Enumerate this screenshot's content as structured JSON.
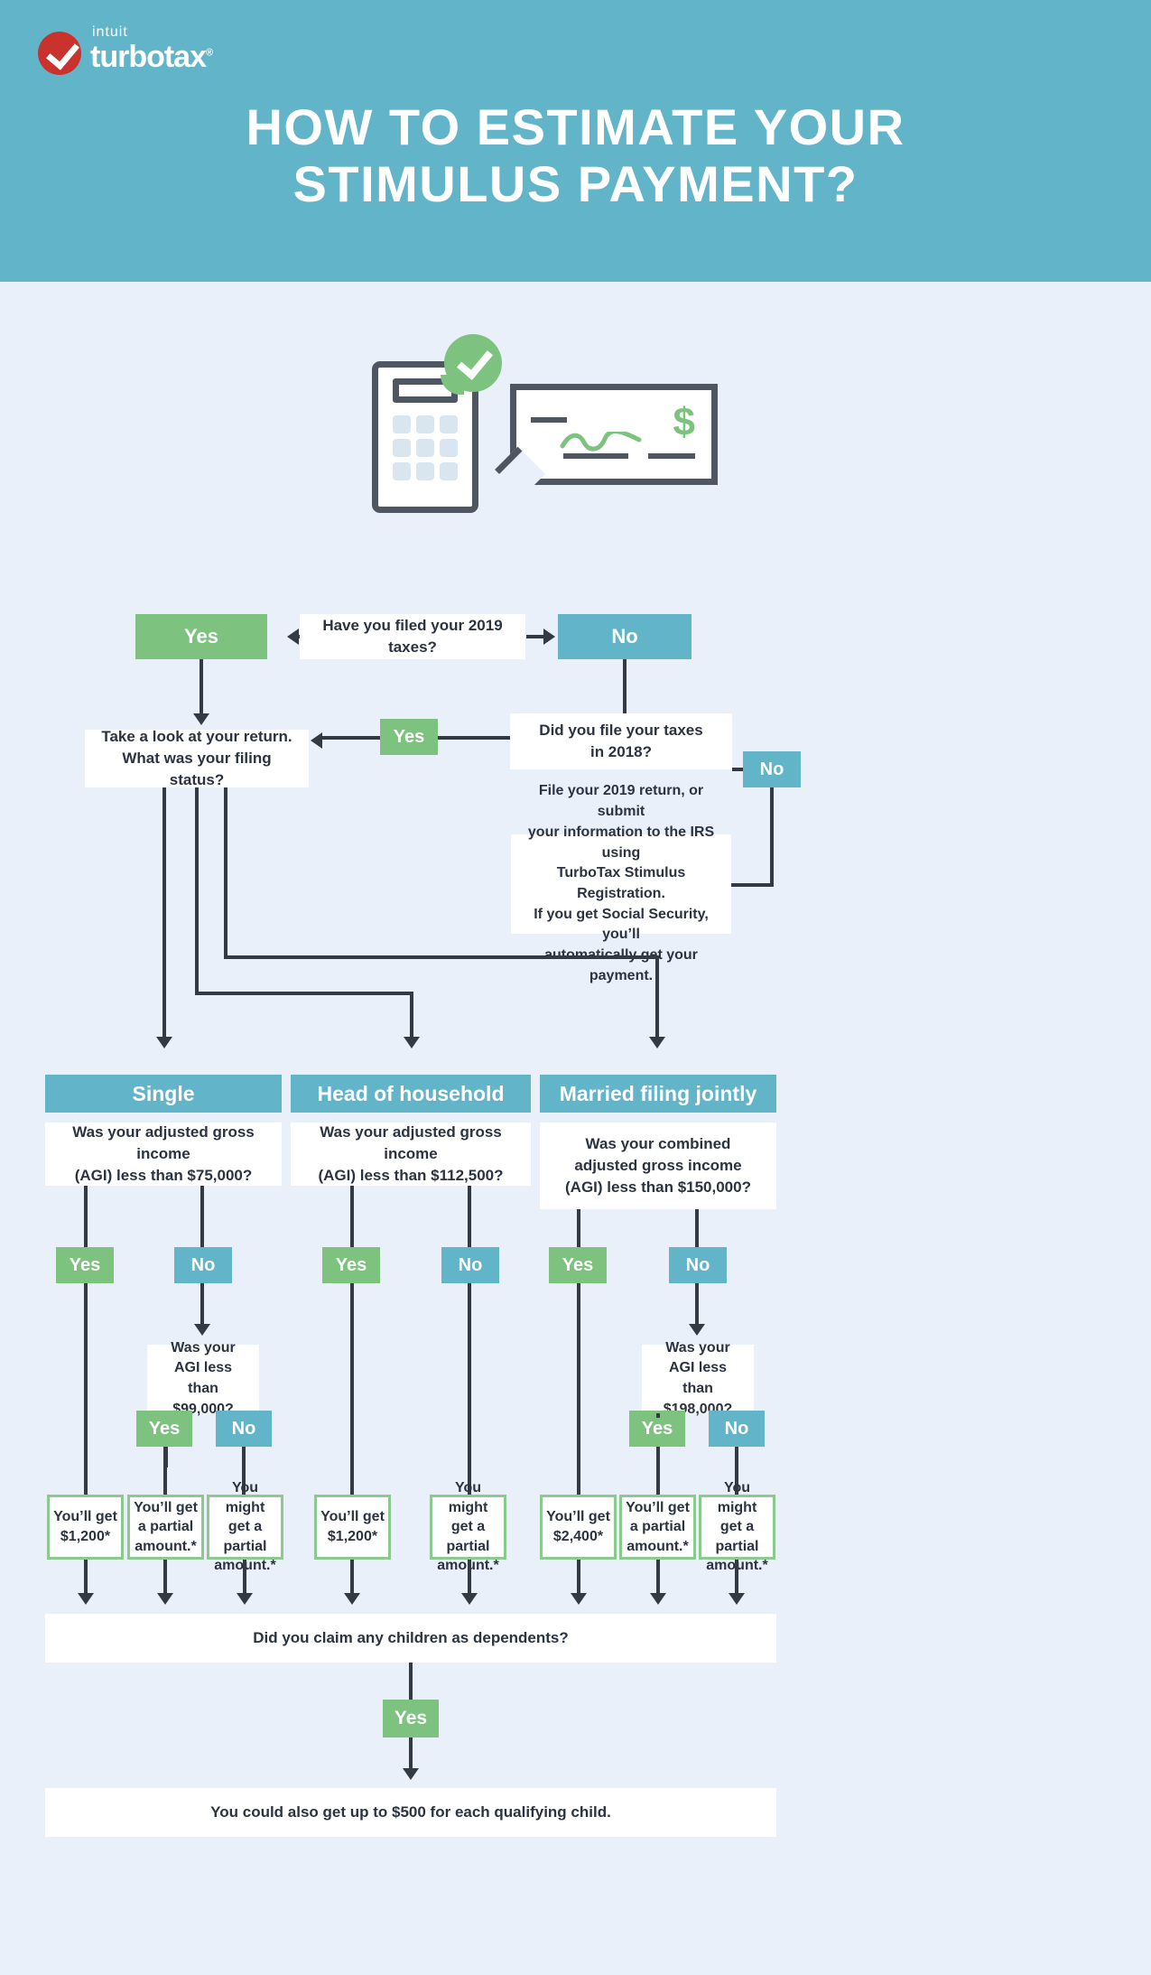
{
  "brand": {
    "intuit": "intuit",
    "product": "turbotax",
    "registered": "®",
    "accent_teal": "#62b4c8",
    "accent_green": "#7dc27f",
    "accent_red": "#c9322d",
    "page_bg": "#eaf0fa",
    "ink": "#333a42"
  },
  "header": {
    "title_line1": "HOW TO ESTIMATE YOUR",
    "title_line2": "STIMULUS PAYMENT?"
  },
  "illustration": {
    "calculator_icon": "calculator-icon",
    "check_badge_icon": "green-check-badge-icon",
    "check_icon": "paper-check-icon",
    "dollar_symbol": "$"
  },
  "labels": {
    "yes": "Yes",
    "no": "No"
  },
  "flow": {
    "q_filed_2019": "Have you filed your 2019 taxes?",
    "q_take_a_look": "Take a look at your return. What was your filing status?",
    "q_take_a_look_l1": "Take a look at your return.",
    "q_take_a_look_l2": "What was your filing status?",
    "q_filed_2018_l1": "Did you file your taxes",
    "q_filed_2018_l2": "in 2018?",
    "note_register_l1": "File your 2019 return, or submit",
    "note_register_l2": "your information to the IRS using",
    "note_register_l3": "TurboTax Stimulus Registration.",
    "note_register_l4": "If you get Social Security, you’ll",
    "note_register_l5": "automatically get your payment."
  },
  "columns": [
    {
      "id": "single",
      "header": "Single",
      "question_lead_l1": "Was your adjusted gross income",
      "question_lead_l2": "(AGI) less than ",
      "question_amount": "$75,000?",
      "branch_yes": "Yes",
      "branch_no": "No",
      "sub_question_l1": "Was your",
      "sub_question_l2": "AGI less than",
      "sub_question_amount": "$99,000?",
      "sub_branch_yes": "Yes",
      "sub_branch_no": "No",
      "results": [
        {
          "line1": "You’ll get",
          "line2": "$1,200*"
        },
        {
          "line1": "You’ll get",
          "line2": "a partial",
          "line3": "amount.*"
        },
        {
          "line1": "You might",
          "line2": "get a partial",
          "line3": "amount.*"
        }
      ]
    },
    {
      "id": "head-of-household",
      "header": "Head of household",
      "question_lead_l1": "Was your adjusted gross income",
      "question_lead_l2": "(AGI) less than ",
      "question_amount": "$112,500?",
      "branch_yes": "Yes",
      "branch_no": "No",
      "results": [
        {
          "line1": "You’ll get",
          "line2": "$1,200*"
        },
        {
          "line1": "You might",
          "line2": "get a partial",
          "line3": "amount.*"
        }
      ]
    },
    {
      "id": "married-filing-jointly",
      "header": "Married filing jointly",
      "question_lead_l1": "Was your combined",
      "question_lead_l2": "adjusted gross income",
      "question_lead_l3": "(AGI) less than ",
      "question_amount": "$150,000?",
      "branch_yes": "Yes",
      "branch_no": "No",
      "sub_question_l1": "Was your",
      "sub_question_l2": "AGI less than",
      "sub_question_amount": "$198,000?",
      "sub_branch_yes": "Yes",
      "sub_branch_no": "No",
      "results": [
        {
          "line1": "You’ll get",
          "line2": "$2,400*"
        },
        {
          "line1": "You’ll get",
          "line2": "a partial",
          "line3": "amount.*"
        },
        {
          "line1": "You might",
          "line2": "get a partial",
          "line3": "amount.*"
        }
      ]
    }
  ],
  "footer": {
    "q_children": "Did you claim any children as dependents?",
    "children_yes": "Yes",
    "answer_children": "You could also get up to $500 for each qualifying child."
  }
}
